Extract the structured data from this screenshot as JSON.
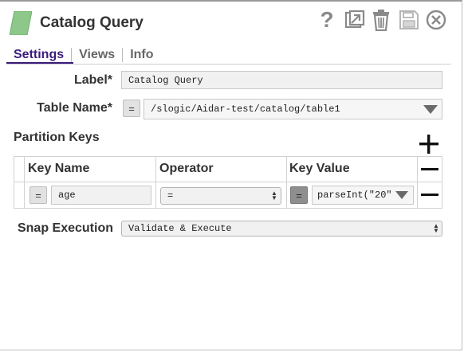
{
  "header": {
    "title": "Catalog Query",
    "icons": [
      "snap-logo-icon",
      "help-icon",
      "export-icon",
      "delete-icon",
      "save-icon",
      "close-icon"
    ],
    "help_glyph": "?"
  },
  "tabs": [
    {
      "label": "Settings",
      "active": true
    },
    {
      "label": "Views",
      "active": false
    },
    {
      "label": "Info",
      "active": false
    }
  ],
  "form": {
    "label": {
      "label": "Label*",
      "value": "Catalog Query"
    },
    "table_name": {
      "label": "Table Name*",
      "eq": "=",
      "value": "/slogic/Aidar-test/catalog/table1"
    },
    "partition_keys": {
      "title": "Partition Keys",
      "columns": [
        "Key Name",
        "Operator",
        "Key Value"
      ],
      "rows": [
        {
          "key_eq": "=",
          "key_name": "age",
          "operator": "=",
          "value_eq": "=",
          "key_value": "parseInt(\"20\""
        }
      ]
    },
    "snap_execution": {
      "label": "Snap Execution",
      "value": "Validate & Execute"
    }
  },
  "colors": {
    "accent_tab": "#3b1d7a",
    "logo_green": "#8dc88a",
    "icon_gray": "#8a8a8a"
  }
}
